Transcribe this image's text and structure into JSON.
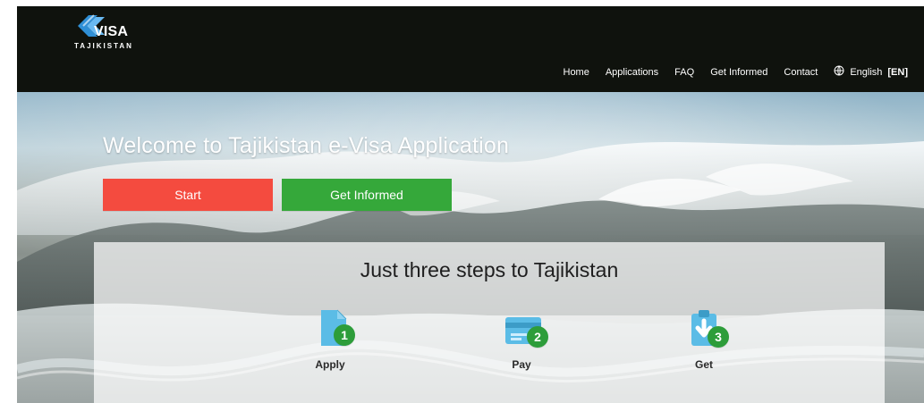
{
  "header": {
    "brand": {
      "name": "VISA",
      "subtitle": "TAJIKISTAN"
    },
    "nav": [
      {
        "label": "Home"
      },
      {
        "label": "Applications"
      },
      {
        "label": "FAQ"
      },
      {
        "label": "Get Informed"
      },
      {
        "label": "Contact"
      }
    ],
    "language": {
      "label": "English",
      "code": "[EN]"
    }
  },
  "hero": {
    "title": "Welcome to Tajikistan e-Visa Application",
    "buttons": {
      "start": "Start",
      "get_informed": "Get Informed"
    }
  },
  "steps_panel": {
    "title": "Just three steps to Tajikistan",
    "steps": [
      {
        "label": "Apply",
        "number": "1",
        "icon": "document-icon"
      },
      {
        "label": "Pay",
        "number": "2",
        "icon": "credit-card-icon"
      },
      {
        "label": "Get",
        "number": "3",
        "icon": "download-clipboard-icon"
      }
    ]
  },
  "colors": {
    "header_bg": "#0f120d",
    "start_button": "#f44b3f",
    "informed_button": "#35a83a",
    "step_icon_blue": "#5bbce6",
    "step_badge_green": "#2d9d3a",
    "panel_bg": "#ffffffb8"
  }
}
